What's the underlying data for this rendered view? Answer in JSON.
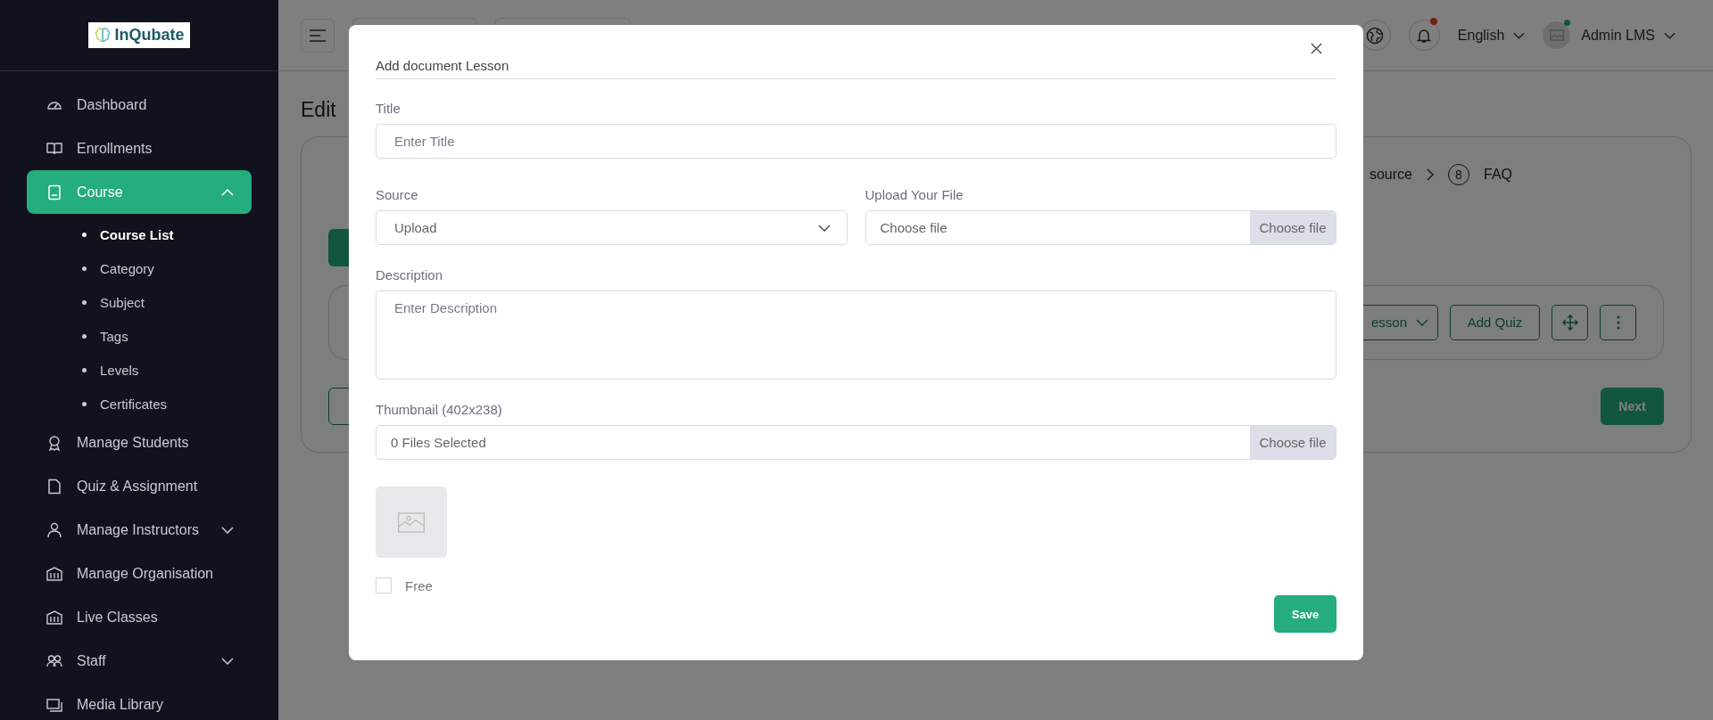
{
  "sidebar": {
    "logo": "InQubate",
    "items": [
      {
        "label": "Dashboard",
        "selected": false
      },
      {
        "label": "Enrollments",
        "selected": false
      },
      {
        "label": "Course",
        "selected": true,
        "expanded": true,
        "children": [
          {
            "label": "Course List",
            "selected": true
          },
          {
            "label": "Category",
            "selected": false
          },
          {
            "label": "Subject",
            "selected": false
          },
          {
            "label": "Tags",
            "selected": false
          },
          {
            "label": "Levels",
            "selected": false
          },
          {
            "label": "Certificates",
            "selected": false
          }
        ]
      },
      {
        "label": "Manage Students",
        "selected": false
      },
      {
        "label": "Quiz & Assignment",
        "selected": false
      },
      {
        "label": "Manage Instructors",
        "selected": false,
        "expanded": false
      },
      {
        "label": "Manage Organisation",
        "selected": false
      },
      {
        "label": "Live Classes",
        "selected": false
      },
      {
        "label": "Staff",
        "selected": false,
        "expanded": false
      },
      {
        "label": "Media Library",
        "selected": false
      }
    ]
  },
  "topbar": {
    "notifications_unread": true,
    "language": "English",
    "user": "Admin LMS",
    "user_online": true
  },
  "page": {
    "title": "Edit",
    "steps_tail": {
      "step_text": "source",
      "step_number": "8",
      "step_label": "FAQ"
    },
    "lesson_row": {
      "dropdown": "esson",
      "add_quiz": "Add Quiz"
    },
    "next": "Next"
  },
  "modal": {
    "title": "Add document Lesson",
    "title_field": {
      "label": "Title",
      "placeholder": "Enter Title"
    },
    "source": {
      "label": "Source",
      "value": "Upload"
    },
    "upload": {
      "label": "Upload Your File",
      "value": "Choose file",
      "button": "Choose file"
    },
    "description": {
      "label": "Description",
      "placeholder": "Enter Description"
    },
    "thumbnail": {
      "label": "Thumbnail (402x238)",
      "value": "0 Files Selected",
      "button": "Choose file"
    },
    "free": {
      "label": "Free",
      "checked": false
    },
    "save": "Save"
  }
}
